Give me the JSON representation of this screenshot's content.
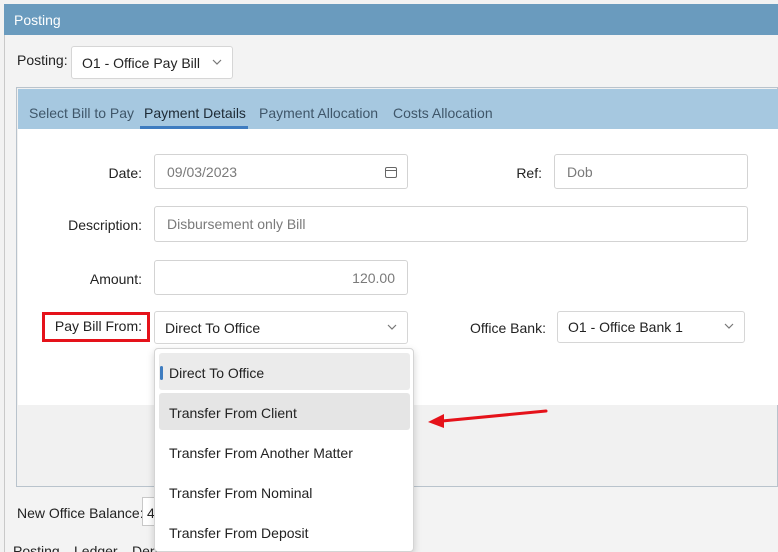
{
  "window": {
    "title": "Posting"
  },
  "posting": {
    "label": "Posting:",
    "value": "O1 - Office Pay Bill"
  },
  "tabs": [
    {
      "label": "Select Bill to Pay"
    },
    {
      "label": "Payment Details"
    },
    {
      "label": "Payment Allocation"
    },
    {
      "label": "Costs Allocation"
    }
  ],
  "form": {
    "date_label": "Date:",
    "date_value": "09/03/2023",
    "ref_label": "Ref:",
    "ref_value": "Dob",
    "description_label": "Description:",
    "description_value": "Disbursement only Bill",
    "amount_label": "Amount:",
    "amount_value": "120.00",
    "pay_bill_from_label": "Pay Bill From:",
    "pay_bill_from_value": "Direct To Office",
    "office_bank_label": "Office Bank:",
    "office_bank_value": "O1 - Office Bank 1"
  },
  "dropdown": {
    "options": [
      "Direct To Office",
      "Transfer From Client",
      "Transfer From Another Matter",
      "Transfer From Nominal",
      "Transfer From Deposit"
    ],
    "selected": "Direct To Office",
    "hovered": "Transfer From Client"
  },
  "balance": {
    "label": "New Office Balance:",
    "value": "4"
  },
  "bottom_tabs": [
    "Posting",
    "Ledger",
    "Dep"
  ],
  "colors": {
    "titlebar": "#6a9bbe",
    "tabbar": "#a6c8e0",
    "highlight": "#e5121a",
    "accent": "#3e7cc0"
  }
}
